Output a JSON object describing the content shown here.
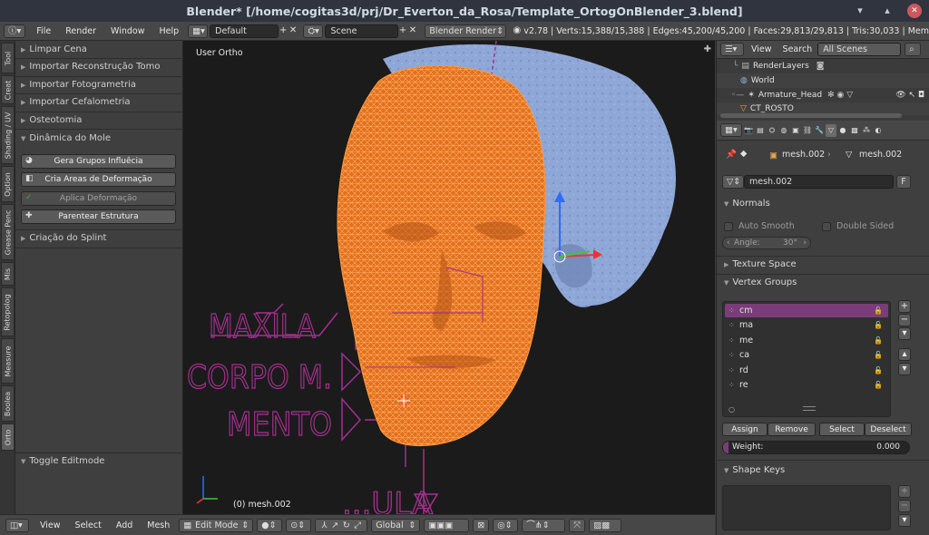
{
  "window": {
    "title": "Blender* [/home/cogitas3d/prj/Dr_Everton_da_Rosa/Template_OrtogOnBlender_3.blend]"
  },
  "info_header": {
    "menus": [
      "File",
      "Render",
      "Window",
      "Help"
    ],
    "screen_layout": "Default",
    "scene": "Scene",
    "render_engine": "Blender Render",
    "stats": "v2.78 | Verts:15,388/15,388 | Edges:45,200/45,200 | Faces:29,813/29,813 | Tris:30,033 | Mem"
  },
  "left_tabs": [
    "Tool",
    "Creat",
    "Shading / UV",
    "Option",
    "Grease Penc",
    "Mis",
    "Retopolog",
    "Measure",
    "Boolea",
    "Orto"
  ],
  "tool_shelf": {
    "panels": [
      "Limpar Cena",
      "Importar Reconstrução Tomo",
      "Importar Fotogrametria",
      "Importar Cefalometria",
      "Osteotomia"
    ],
    "mole_panel": "Dinâmica do Mole",
    "buttons": [
      "Gera Grupos Influêcia",
      "Cria Areas de Deformação",
      "Aplica Deformação",
      "Parentear Estrutura"
    ],
    "splint_panel": "Criação do Splint",
    "toggle_panel": "Toggle Editmode"
  },
  "viewport": {
    "view_label": "User Ortho",
    "object_label": "(0) mesh.002",
    "text_labels": [
      "MAXILA",
      "CORPO M.",
      "MENTO",
      "...ULA"
    ]
  },
  "view3d_header": {
    "menus": [
      "View",
      "Select",
      "Add",
      "Mesh"
    ],
    "mode": "Edit Mode",
    "orientation": "Global"
  },
  "outliner": {
    "view_menu": "View",
    "search_menu": "Search",
    "filter": "All Scenes",
    "rows": [
      "RenderLayers",
      "World",
      "Armature_Head",
      "CT_ROSTO"
    ]
  },
  "properties": {
    "breadcrumb_mesh": "mesh.002",
    "breadcrumb_data": "mesh.002",
    "data_name": "mesh.002",
    "fake_user": "F",
    "normals_header": "Normals",
    "auto_smooth": "Auto Smooth",
    "double_sided": "Double Sided",
    "angle_label": "Angle:",
    "angle_value": "30°",
    "texture_space_header": "Texture Space",
    "vertex_groups_header": "Vertex Groups",
    "vertex_groups": [
      "cm",
      "ma",
      "me",
      "ca",
      "rd",
      "re"
    ],
    "assign": "Assign",
    "remove": "Remove",
    "select": "Select",
    "deselect": "Deselect",
    "weight_label": "Weight:",
    "weight_value": "0.000",
    "shape_keys_header": "Shape Keys"
  },
  "colors": {
    "face_wire": "#e87a26",
    "skull": "#8fa7d6",
    "annotation": "#a4308f",
    "selected_group": "#7a3d7a"
  }
}
